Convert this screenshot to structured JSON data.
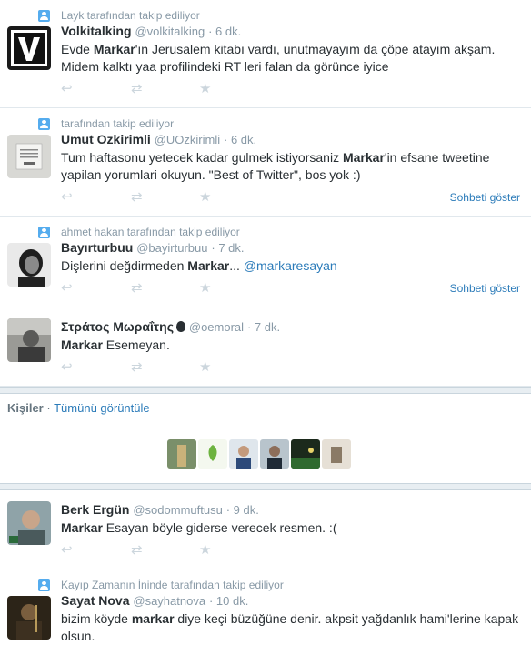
{
  "tweets": [
    {
      "context": "Layk tarafından takip ediliyor",
      "name": "Volkitalking",
      "handle": "@volkitalking",
      "time": "· 6 dk.",
      "text_html": "Evde <b>Markar</b>'ın Jerusalem kitabı vardı, unutmayayım da çöpe atayım akşam. Midem kalktı yaa profilindeki RT leri falan da görünce iyice",
      "conversation": ""
    },
    {
      "context": "tarafından takip ediliyor",
      "name": "Umut Ozkirimli",
      "handle": "@UOzkirimli",
      "time": "· 6 dk.",
      "text_html": "Tum haftasonu yetecek kadar gulmek istiyorsaniz <b>Markar</b>'in efsane tweetine yapilan yorumlari okuyun. \"Best of Twitter\", bos yok :)",
      "conversation": "Sohbeti göster"
    },
    {
      "context": "ahmet hakan tarafından takip ediliyor",
      "name": "Bayırturbuu",
      "handle": "@bayirturbuu",
      "time": "· 7 dk.",
      "text_html": "Dişlerini değdirmeden <b>Markar</b>... <span class='mention'>@markaresayan</span>",
      "conversation": "Sohbeti göster"
    },
    {
      "context": "",
      "name": "Στράτος Μωραΐτης",
      "handle": "@oemoral",
      "time": "· 7 dk.",
      "text_html": "<b>Markar</b> Esemeyan.",
      "conversation": ""
    }
  ],
  "people": {
    "label": "Kişiler",
    "separator": "·",
    "view_all": "Tümünü görüntüle"
  },
  "tweets2": [
    {
      "context": "",
      "name": "Berk Ergün",
      "handle": "@sodommuftusu",
      "time": "· 9 dk.",
      "text_html": "<b>Markar</b> Esayan böyle giderse verecek resmen. :(",
      "conversation": ""
    },
    {
      "context": "Kayıp Zamanın İninde tarafından takip ediliyor",
      "name": "Sayat Nova",
      "handle": "@sayhatnova",
      "time": "· 10 dk.",
      "text_html": "bizim köyde <b>markar</b> diye keçi büzüğüne denir. akpsit yağdanlık hami'lerine kapak olsun.",
      "conversation": ""
    }
  ],
  "icons": {
    "reply": "reply-icon",
    "retweet": "retweet-icon",
    "favorite": "star-icon",
    "context": "person-follow-icon"
  },
  "colors": {
    "link": "#2b7bb9",
    "muted": "#8899a6",
    "text": "#292f33",
    "action": "#ccd6dd"
  }
}
